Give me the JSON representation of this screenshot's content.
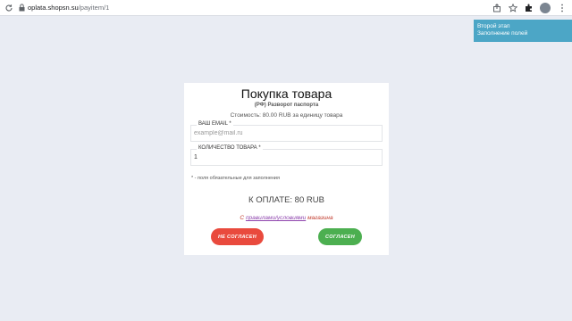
{
  "browser": {
    "url_host": "oplata.shopsn.su",
    "url_path": "/payitem/1"
  },
  "toast": {
    "line1": "Второй этап",
    "line2": "Заполнение полей"
  },
  "form": {
    "title": "Покупка товара",
    "subtitle": "(РФ) Разворот паспорта",
    "price_text": "Стоимость: 80.00 RUB за единицу товара",
    "email_label": "ВАШ EMAIL *",
    "email_placeholder": "example@mail.ru",
    "qty_label": "КОЛИЧЕСТВО ТОВАРА *",
    "qty_value": "1",
    "required_note": "* - поля обязательные для заполнения",
    "total": "К ОПЛАТЕ: 80 RUB",
    "agree_prefix": "С",
    "agree_link": "правилами/условиями",
    "agree_suffix": "магазина",
    "disagree_button": "НЕ СОГЛАСЕН",
    "agree_button": "СОГЛАСЕН"
  },
  "colors": {
    "toast": "#4ca6c6",
    "disagree": "#e94a3d",
    "agree": "#4caf50"
  }
}
